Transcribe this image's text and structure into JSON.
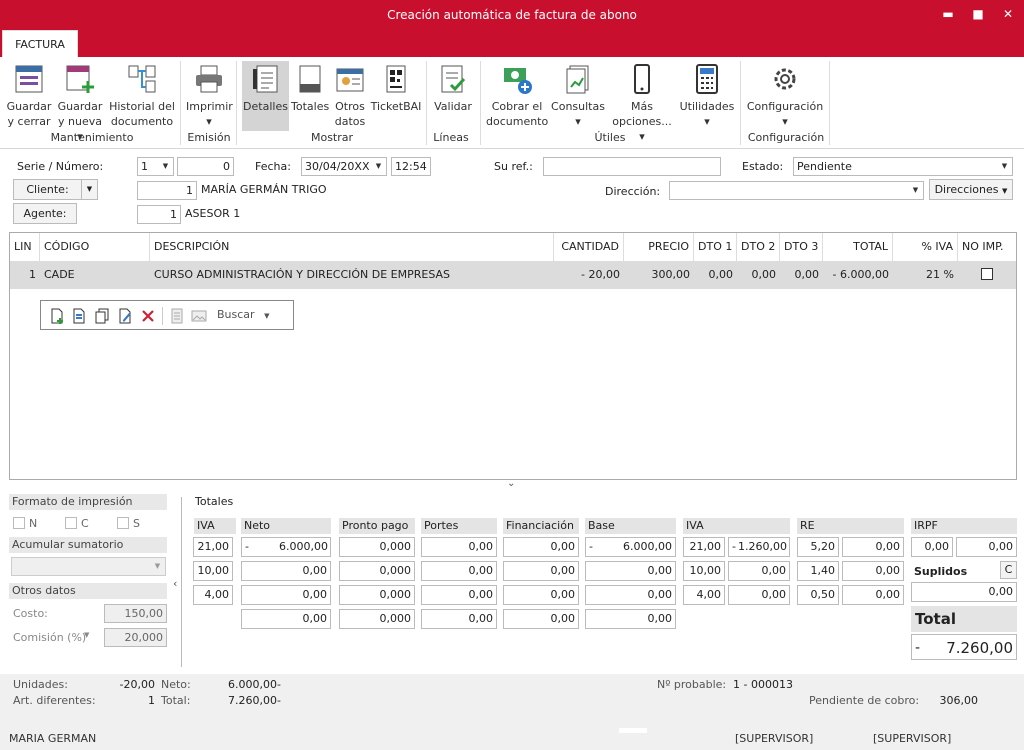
{
  "window": {
    "title": "Creación automática de factura de abono",
    "minimize": "▬",
    "maximize": "■",
    "close": "✕"
  },
  "tab": "FACTURA",
  "ribbon": {
    "buttons": [
      {
        "label1": "Guardar",
        "label2": "y cerrar"
      },
      {
        "label1": "Guardar",
        "label2": "y nueva ▾"
      },
      {
        "label1": "Historial del",
        "label2": "documento"
      },
      {
        "label1": "Imprimir",
        "label2": "▾"
      },
      {
        "label1": "Detalles",
        "label2": ""
      },
      {
        "label1": "Totales",
        "label2": ""
      },
      {
        "label1": "Otros",
        "label2": "datos"
      },
      {
        "label1": "TicketBAI",
        "label2": ""
      },
      {
        "label1": "Validar",
        "label2": ""
      },
      {
        "label1": "Cobrar el",
        "label2": "documento"
      },
      {
        "label1": "Consultas",
        "label2": "▾"
      },
      {
        "label1": "Más",
        "label2": "opciones... ▾"
      },
      {
        "label1": "Utilidades",
        "label2": "▾"
      },
      {
        "label1": "Configuración",
        "label2": "▾"
      }
    ],
    "groups": [
      "Mantenimiento",
      "Emisión",
      "Mostrar",
      "Líneas",
      "Útiles",
      "Configuración"
    ]
  },
  "header": {
    "serie_label": "Serie / Número:",
    "serie": "1",
    "numero": "0",
    "fecha_label": "Fecha:",
    "fecha": "30/04/20XX",
    "hora": "12:54",
    "suref_label": "Su ref.:",
    "suref": "",
    "estado_label": "Estado:",
    "estado": "Pendiente",
    "cliente_label": "Cliente:",
    "cliente_code": "1",
    "cliente_name": "MARÍA GERMÁN TRIGO",
    "direccion_label": "Dirección:",
    "direccion": "",
    "direcciones_label": "Direcciones",
    "agente_label": "Agente:",
    "agente_code": "1",
    "agente_name": "ASESOR 1"
  },
  "grid": {
    "columns": [
      "LIN",
      "CÓDIGO",
      "DESCRIPCIÓN",
      "CANTIDAD",
      "PRECIO",
      "DTO 1",
      "DTO 2",
      "DTO 3",
      "TOTAL",
      "% IVA",
      "NO IMP."
    ],
    "rows": [
      {
        "lin": "1",
        "codigo": "CADE",
        "descripcion": "CURSO ADMINISTRACIÓN Y DIRECCIÓN DE EMPRESAS",
        "cantidad": "- 20,00",
        "precio": "300,00",
        "dto1": "0,00",
        "dto2": "0,00",
        "dto3": "0,00",
        "total": "- 6.000,00",
        "iva": "21 %",
        "noimp": false
      }
    ],
    "toolbar_search": "Buscar"
  },
  "left_panel": {
    "formato_label": "Formato de impresión",
    "opts": [
      "N",
      "C",
      "S"
    ],
    "acumular_label": "Acumular sumatorio",
    "otros_label": "Otros datos",
    "costo_label": "Costo:",
    "costo": "150,00",
    "comision_label": "Comisión (%)",
    "comision": "20,000"
  },
  "totales": {
    "title": "Totales",
    "headers": [
      "IVA",
      "Neto",
      "Pronto pago",
      "Portes",
      "Financiación",
      "Base",
      "IVA",
      "RE",
      "IRPF"
    ],
    "rows": [
      [
        "21,00",
        "-",
        "6.000,00",
        "0,000",
        "0,00",
        "0,00",
        "-",
        "6.000,00",
        "21,00",
        "-",
        "1.260,00",
        "5,20",
        "0,00",
        "0,00",
        "0,00"
      ],
      [
        "10,00",
        "",
        "0,00",
        "0,000",
        "0,00",
        "0,00",
        "",
        "0,00",
        "10,00",
        "",
        "0,00",
        "1,40",
        "0,00"
      ],
      [
        "4,00",
        "",
        "0,00",
        "0,000",
        "0,00",
        "0,00",
        "",
        "0,00",
        "4,00",
        "",
        "0,00",
        "0,50",
        "0,00"
      ],
      [
        "",
        "",
        "0,00",
        "0,000",
        "0,00",
        "0,00",
        "",
        "0,00"
      ]
    ],
    "suplidos_label": "Suplidos",
    "suplidos_btn": "C",
    "suplidos": "0,00",
    "total_label": "Total",
    "total_sign": "-",
    "total": "7.260,00"
  },
  "status": {
    "unidades_label": "Unidades:",
    "unidades": "-20,00",
    "neto_label": "Neto:",
    "neto": "6.000,00-",
    "art_label": "Art. diferentes:",
    "art": "1",
    "total_label": "Total:",
    "total": "7.260,00-",
    "nprob_label": "Nº probable:",
    "nprob": "1 - 000013",
    "pend_label": "Pendiente de cobro:",
    "pend": "306,00",
    "user": "MARIA GERMAN",
    "sup1": "[SUPERVISOR]",
    "sup2": "[SUPERVISOR]"
  }
}
